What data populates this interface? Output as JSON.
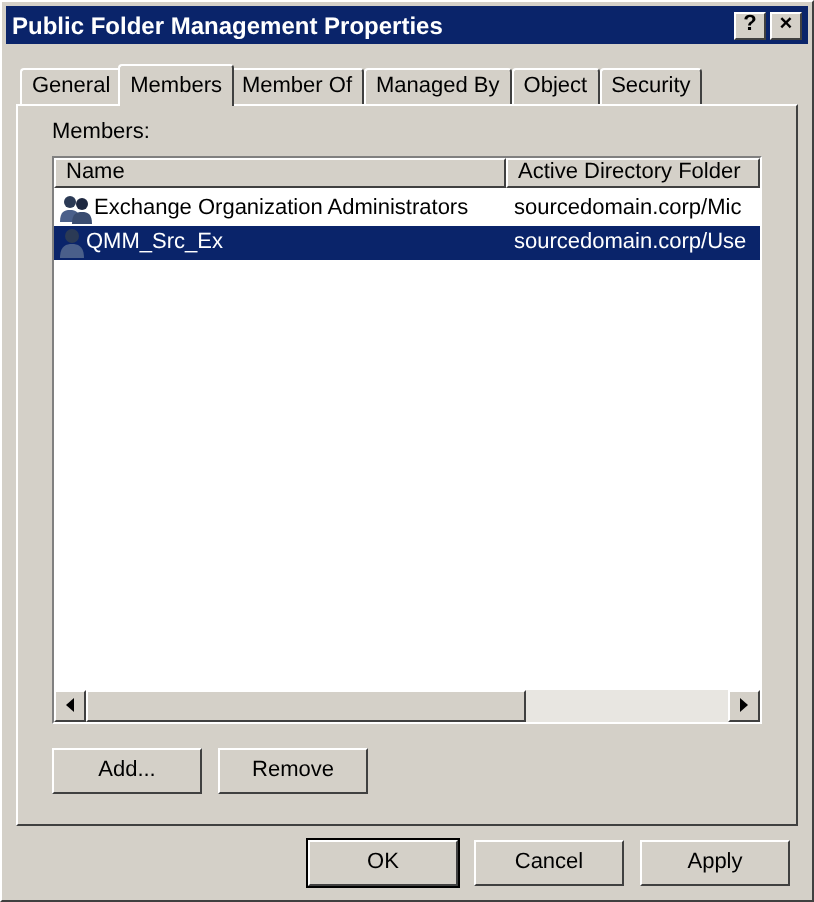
{
  "window": {
    "title": "Public Folder Management Properties",
    "title_buttons": [
      "?",
      "×"
    ]
  },
  "tabs": [
    {
      "label": "General",
      "selected": false
    },
    {
      "label": "Members",
      "selected": true
    },
    {
      "label": "Member Of",
      "selected": false
    },
    {
      "label": "Managed By",
      "selected": false
    },
    {
      "label": "Object",
      "selected": false
    },
    {
      "label": "Security",
      "selected": false
    }
  ],
  "members": {
    "label": "Members:",
    "columns": [
      "Name",
      "Active Directory Folder"
    ],
    "rows": [
      {
        "kind": "group",
        "name": "Exchange Organization Administrators",
        "folder": "sourcedomain.corp/Mic",
        "selected": false
      },
      {
        "kind": "user",
        "name": "QMM_Src_Ex",
        "folder": "sourcedomain.corp/Use",
        "selected": true
      }
    ]
  },
  "member_buttons": [
    "Add...",
    "Remove"
  ],
  "dialog_buttons": [
    {
      "label": "OK",
      "default": true
    },
    {
      "label": "Cancel",
      "default": false
    },
    {
      "label": "Apply",
      "default": false
    }
  ]
}
